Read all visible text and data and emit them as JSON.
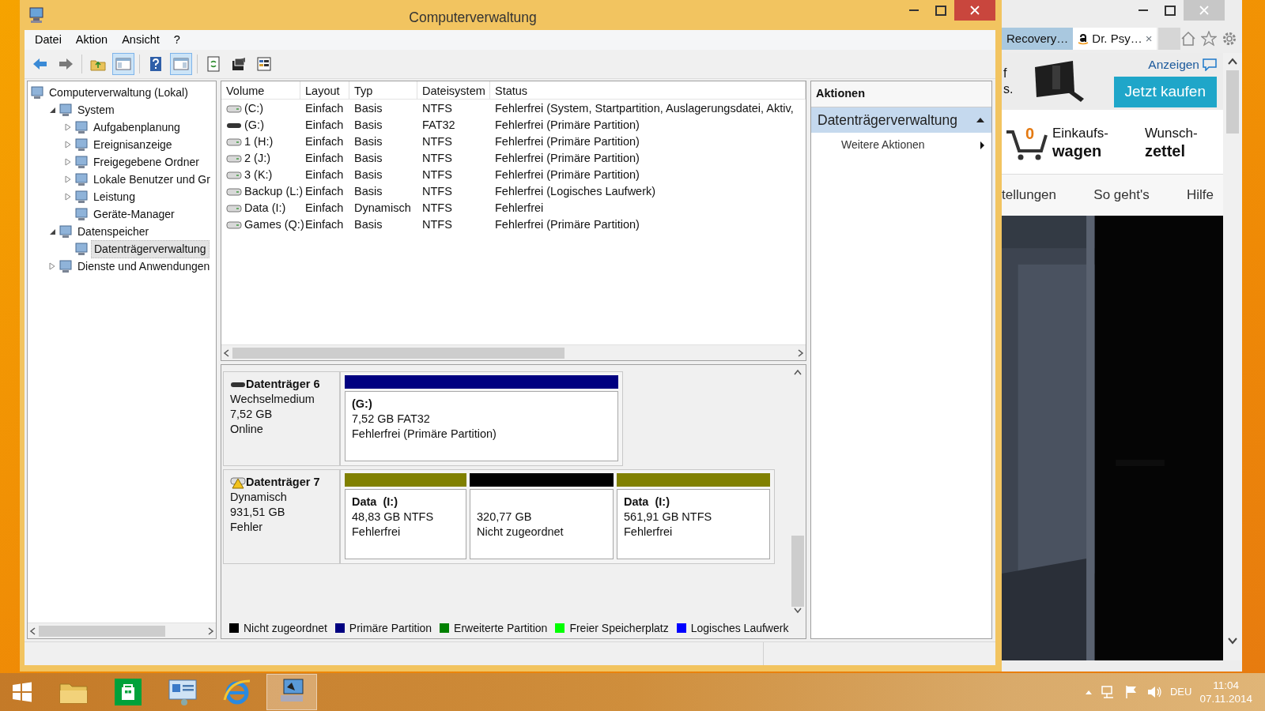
{
  "window": {
    "title": "Computerverwaltung"
  },
  "menu": [
    "Datei",
    "Aktion",
    "Ansicht",
    "?"
  ],
  "toolbar": [
    {
      "kind": "back",
      "pressed": false
    },
    {
      "kind": "forward",
      "pressed": false
    },
    {
      "kind": "up",
      "pressed": false
    },
    {
      "kind": "tree",
      "pressed": true
    },
    {
      "kind": "help",
      "pressed": false
    },
    {
      "kind": "pane",
      "pressed": true
    },
    {
      "kind": "refresh",
      "pressed": false
    },
    {
      "kind": "export",
      "pressed": false
    },
    {
      "kind": "properties",
      "pressed": false
    }
  ],
  "tree": [
    {
      "label": "Computerverwaltung (Lokal)",
      "selected": false,
      "children": [
        {
          "label": "System",
          "expanded": true,
          "selected": false,
          "children": [
            {
              "label": "Aufgabenplanung",
              "expanded": false,
              "selected": false
            },
            {
              "label": "Ereignisanzeige",
              "expanded": false,
              "selected": false
            },
            {
              "label": "Freigegebene Ordner",
              "expanded": false,
              "selected": false
            },
            {
              "label": "Lokale Benutzer und Gr",
              "expanded": false,
              "selected": false
            },
            {
              "label": "Leistung",
              "expanded": false,
              "selected": false
            },
            {
              "label": "Geräte-Manager",
              "selected": false
            }
          ]
        },
        {
          "label": "Datenspeicher",
          "expanded": true,
          "selected": false,
          "children": [
            {
              "label": "Datenträgerverwaltung",
              "selected": true
            }
          ]
        },
        {
          "label": "Dienste und Anwendungen",
          "expanded": false,
          "selected": false
        }
      ]
    }
  ],
  "volumes": {
    "columns": [
      "Volume",
      "Layout",
      "Typ",
      "Dateisystem",
      "Status"
    ],
    "rows": [
      {
        "removable": false,
        "cells": [
          "(C:)",
          "Einfach",
          "Basis",
          "NTFS",
          "Fehlerfrei (System, Startpartition, Auslagerungsdatei, Aktiv,"
        ]
      },
      {
        "removable": true,
        "cells": [
          "(G:)",
          "Einfach",
          "Basis",
          "FAT32",
          "Fehlerfrei (Primäre Partition)"
        ]
      },
      {
        "removable": false,
        "cells": [
          "1 (H:)",
          "Einfach",
          "Basis",
          "NTFS",
          "Fehlerfrei (Primäre Partition)"
        ]
      },
      {
        "removable": false,
        "cells": [
          "2 (J:)",
          "Einfach",
          "Basis",
          "NTFS",
          "Fehlerfrei (Primäre Partition)"
        ]
      },
      {
        "removable": false,
        "cells": [
          "3 (K:)",
          "Einfach",
          "Basis",
          "NTFS",
          "Fehlerfrei (Primäre Partition)"
        ]
      },
      {
        "removable": false,
        "cells": [
          "Backup (L:)",
          "Einfach",
          "Basis",
          "NTFS",
          "Fehlerfrei (Logisches Laufwerk)"
        ]
      },
      {
        "removable": false,
        "cells": [
          "Data (I:)",
          "Einfach",
          "Dynamisch",
          "NTFS",
          "Fehlerfrei"
        ]
      },
      {
        "removable": false,
        "cells": [
          "Games (Q:)",
          "Einfach",
          "Basis",
          "NTFS",
          "Fehlerfrei (Primäre Partition)"
        ]
      }
    ]
  },
  "disks": [
    {
      "name": "Datenträger 6",
      "removable": true,
      "warning": false,
      "info": [
        "Wechselmedium",
        "7,52 GB",
        "Online"
      ],
      "partitions": [
        {
          "label": "(G:)",
          "size": "7,52 GB FAT32",
          "status": "Fehlerfrei (Primäre Partition)",
          "color": "#000080"
        }
      ]
    },
    {
      "name": "Datenträger 7",
      "removable": false,
      "warning": true,
      "info": [
        "Dynamisch",
        "931,51 GB",
        "Fehler"
      ],
      "partitions": [
        {
          "label": "Data  (I:)",
          "size": "48,83 GB NTFS",
          "status": "Fehlerfrei",
          "color": "#808000"
        },
        {
          "size": "320,77 GB",
          "status": "Nicht zugeordnet",
          "color": "#000000"
        },
        {
          "label": "Data  (I:)",
          "size": "561,91 GB NTFS",
          "status": "Fehlerfrei",
          "color": "#808000"
        }
      ]
    }
  ],
  "legend": [
    {
      "label": "Nicht zugeordnet",
      "color": "#000000"
    },
    {
      "label": "Primäre Partition",
      "color": "#000080"
    },
    {
      "label": "Erweiterte Partition",
      "color": "#008000"
    },
    {
      "label": "Freier Speicherplatz",
      "color": "#00ff00"
    },
    {
      "label": "Logisches Laufwerk",
      "color": "#0000ff"
    }
  ],
  "actions": {
    "title": "Aktionen",
    "sections": [
      {
        "label": "Datenträgerverwaltung",
        "expanded": true,
        "items": [
          {
            "label": "Weitere Aktionen",
            "submenu": true
          }
        ]
      }
    ]
  },
  "browser": {
    "tabs": [
      {
        "label": "Recovery…",
        "selected": false,
        "closable": false
      },
      {
        "label": "Dr. Psy…",
        "selected": true,
        "closable": true
      }
    ],
    "close_glyph": "×",
    "ad": {
      "fragments": [
        "f",
        "s."
      ],
      "ad_link": "Anzeigen",
      "button": "Jetzt kaufen"
    },
    "cart": {
      "count": "0",
      "label_top": "Einkaufs-",
      "label_bottom": "wagen"
    },
    "wishlist": {
      "label_top": "Wunsch-",
      "label_bottom": "zettel"
    },
    "nav": [
      "tellungen",
      "So geht's",
      "Hilfe"
    ]
  },
  "taskbar": {
    "apps": [
      {
        "kind": "explorer",
        "selected": false
      },
      {
        "kind": "store",
        "selected": false
      },
      {
        "kind": "control",
        "selected": false
      },
      {
        "kind": "ie",
        "selected": false
      },
      {
        "kind": "compmgmt",
        "selected": true
      }
    ],
    "language": "DEU",
    "time": "11:04",
    "date": "07.11.2014"
  }
}
